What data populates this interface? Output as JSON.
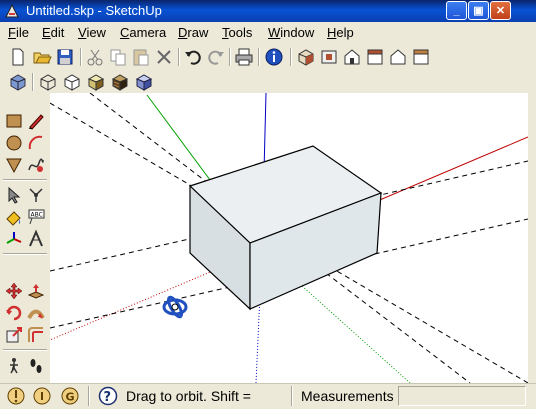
{
  "window": {
    "title": "Untitled.skp - SketchUp",
    "minimize": "_",
    "maximize": "▣",
    "close": "✕"
  },
  "menus": [
    {
      "label": "File",
      "key": "F",
      "rest": "ile"
    },
    {
      "label": "Edit",
      "key": "E",
      "rest": "dit"
    },
    {
      "label": "View",
      "key": "V",
      "rest": "iew"
    },
    {
      "label": "Camera",
      "key": "C",
      "rest": "amera"
    },
    {
      "label": "Draw",
      "key": "D",
      "rest": "raw"
    },
    {
      "label": "Tools",
      "key": "T",
      "rest": "ools"
    },
    {
      "label": "Window",
      "key": "W",
      "rest": "indow"
    },
    {
      "label": "Help",
      "key": "H",
      "rest": "elp"
    }
  ],
  "toolbar": {
    "standard_icons": [
      "new-icon",
      "open-icon",
      "save-icon",
      "cut-icon",
      "copy-icon",
      "paste-icon",
      "erase-icon",
      "undo-icon",
      "redo-icon",
      "print-icon",
      "model-info-icon"
    ],
    "view_icons": [
      "iso-view-icon",
      "top-view-icon",
      "front-view-icon",
      "right-view-icon",
      "back-view-icon",
      "left-view-icon"
    ],
    "style_icons": [
      "xray-icon",
      "wireframe-icon",
      "hidden-line-icon",
      "shaded-icon",
      "shaded-texture-icon",
      "monochrome-icon"
    ]
  },
  "status": {
    "hint": "Drag to orbit.  Shift =",
    "measurements_label": "Measurements",
    "measurements_value": ""
  },
  "colors": {
    "title_bar": "#0852d4",
    "axis_red": "#c00000",
    "axis_green": "#00a000",
    "axis_blue": "#0000c0",
    "box_face": "#dfe6ea"
  }
}
